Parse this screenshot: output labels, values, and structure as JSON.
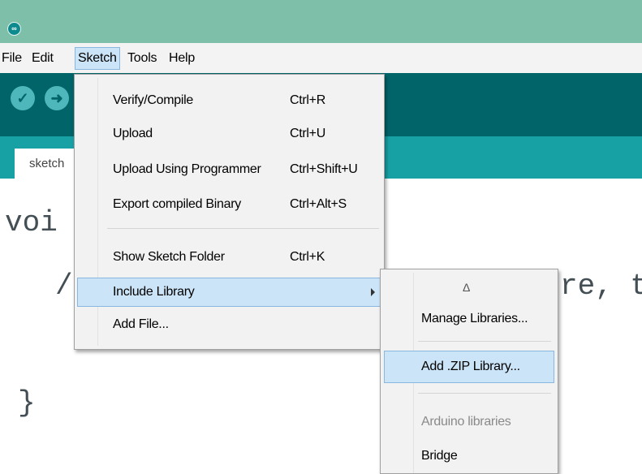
{
  "menubar": {
    "items": [
      "File",
      "Edit",
      "Sketch",
      "Tools",
      "Help"
    ]
  },
  "toolbar": {
    "verify_icon": "check-icon",
    "upload_icon": "arrow-right-icon"
  },
  "tab": {
    "label": "sketch"
  },
  "editor": {
    "line1": "voi",
    "line2": "/",
    "line2_tail": "re, t",
    "line3": "}"
  },
  "sketch_menu": {
    "items": [
      {
        "label": "Verify/Compile",
        "shortcut": "Ctrl+R"
      },
      {
        "label": "Upload",
        "shortcut": "Ctrl+U"
      },
      {
        "label": "Upload Using Programmer",
        "shortcut": "Ctrl+Shift+U"
      },
      {
        "label": "Export compiled Binary",
        "shortcut": "Ctrl+Alt+S"
      },
      {
        "label": "Show Sketch Folder",
        "shortcut": "Ctrl+K"
      },
      {
        "label": "Include Library",
        "shortcut": ""
      },
      {
        "label": "Add File...",
        "shortcut": ""
      }
    ]
  },
  "include_library_submenu": {
    "scroll_indicator": "Δ",
    "items": [
      {
        "label": "Manage Libraries..."
      },
      {
        "label": "Add .ZIP Library..."
      },
      {
        "label": "Arduino libraries"
      },
      {
        "label": "Bridge"
      }
    ]
  },
  "colors": {
    "titlebar": "#7dbfa8",
    "toolbar": "#006468",
    "tabstrip": "#17a1a5",
    "highlight": "#cce4f7"
  }
}
